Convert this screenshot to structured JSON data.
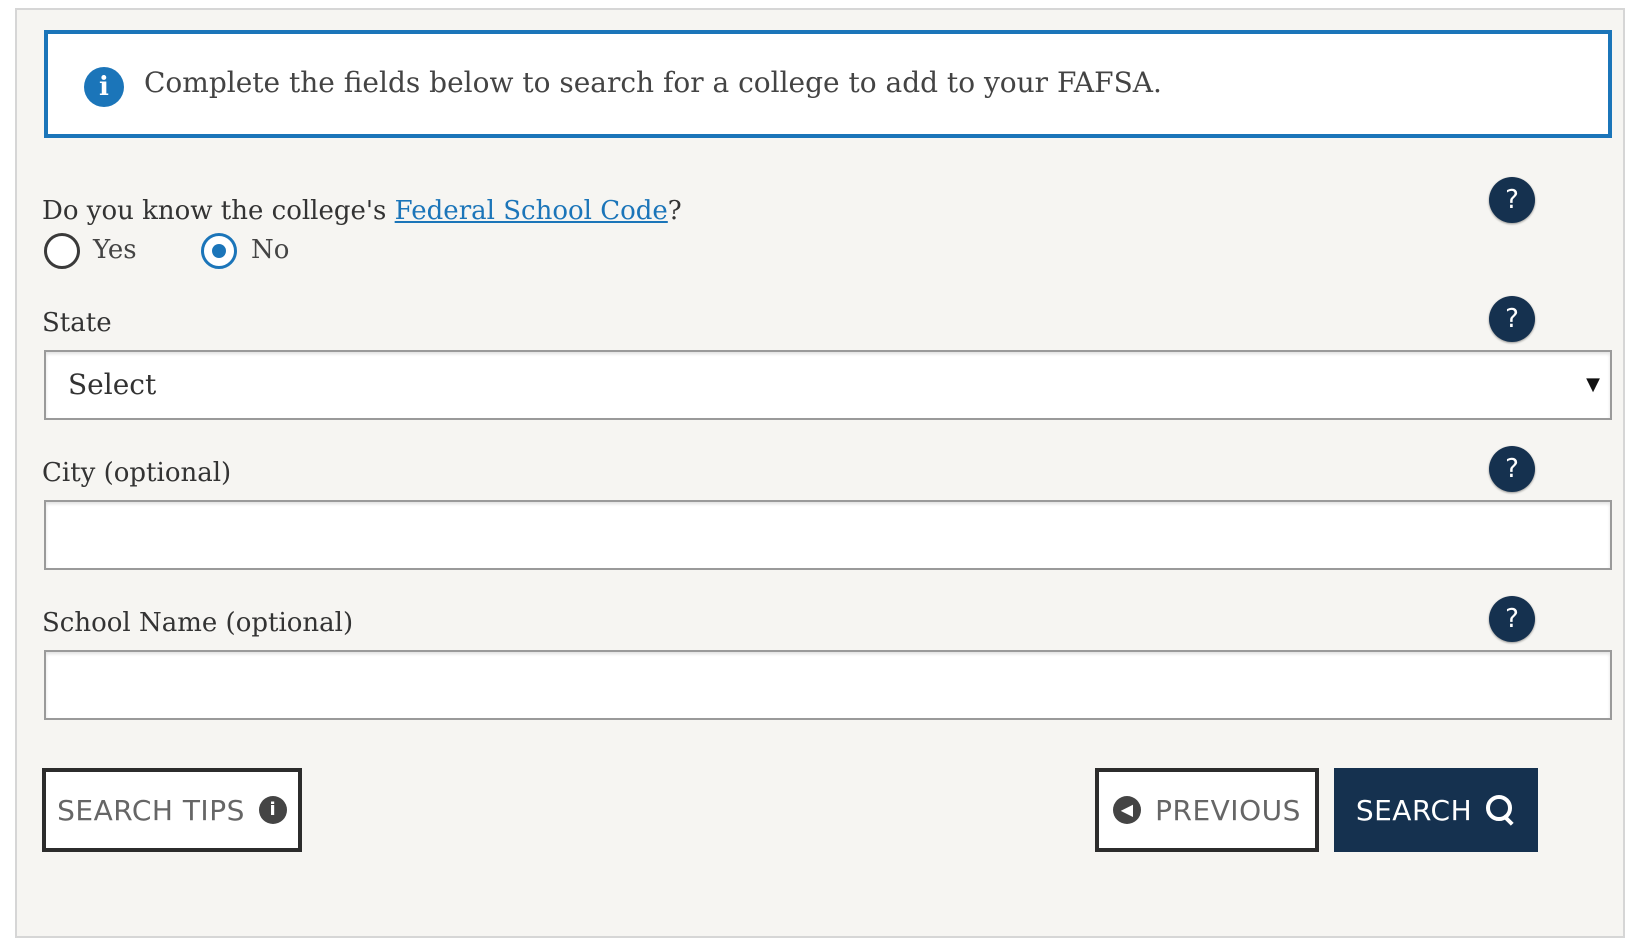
{
  "alert": {
    "text": "Complete the fields below to search for a college to add to your FAFSA.",
    "icon": "info-icon"
  },
  "question": {
    "prefix": "Do you know the college's ",
    "link_text": "Federal School Code",
    "suffix": "?",
    "options": [
      {
        "label": "Yes",
        "checked": false
      },
      {
        "label": "No",
        "checked": true
      }
    ]
  },
  "state": {
    "label": "State",
    "selected": "Select"
  },
  "city": {
    "label": "City (optional)",
    "value": ""
  },
  "school": {
    "label": "School Name (optional)",
    "value": ""
  },
  "help": {
    "glyph": "?"
  },
  "buttons": {
    "tips": "SEARCH TIPS",
    "previous": "PREVIOUS",
    "search": "SEARCH"
  },
  "colors": {
    "accent": "#1b75b9",
    "primary_button": "#15314f",
    "panel_bg": "#f6f5f2"
  }
}
